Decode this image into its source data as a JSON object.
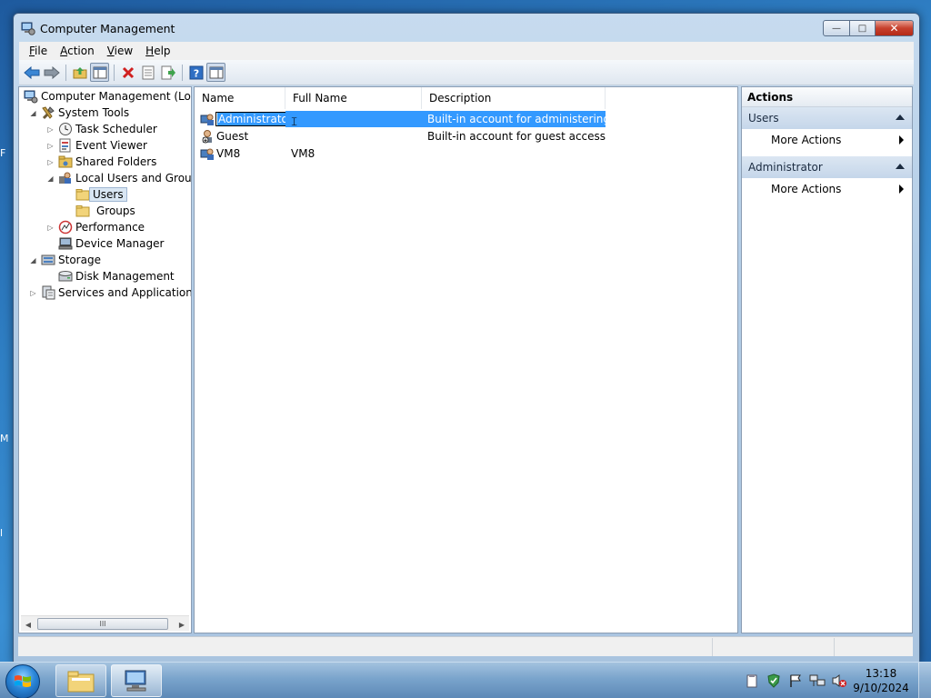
{
  "desktop": {
    "edge_glyphs": [
      "F",
      "M",
      "l"
    ]
  },
  "window": {
    "title": "Computer Management",
    "caption": {
      "minimize": "—",
      "maximize": "□",
      "close": "✕"
    }
  },
  "menu": [
    {
      "key": "F",
      "rest": "ile"
    },
    {
      "key": "A",
      "rest": "ction"
    },
    {
      "key": "V",
      "rest": "iew"
    },
    {
      "key": "H",
      "rest": "elp"
    }
  ],
  "toolbar": {
    "buttons": [
      "back-icon",
      "forward-icon",
      "up-folder-icon",
      "show-hide-tree-icon",
      "delete-icon",
      "properties-icon",
      "export-list-icon",
      "help-icon",
      "show-action-pane-icon"
    ]
  },
  "tree": {
    "items": [
      {
        "label": "Computer Management (Local",
        "icon": "computer-management-icon"
      },
      {
        "label": "System Tools",
        "icon": "system-tools-icon"
      },
      {
        "label": "Task Scheduler",
        "icon": "clock-icon"
      },
      {
        "label": "Event Viewer",
        "icon": "event-viewer-icon"
      },
      {
        "label": "Shared Folders",
        "icon": "shared-folders-icon"
      },
      {
        "label": "Local Users and Groups",
        "icon": "users-groups-icon"
      },
      {
        "label": "Users",
        "icon": "folder-icon"
      },
      {
        "label": "Groups",
        "icon": "folder-icon"
      },
      {
        "label": "Performance",
        "icon": "performance-icon"
      },
      {
        "label": "Device Manager",
        "icon": "device-manager-icon"
      },
      {
        "label": "Storage",
        "icon": "storage-icon"
      },
      {
        "label": "Disk Management",
        "icon": "disk-icon"
      },
      {
        "label": "Services and Applications",
        "icon": "services-icon"
      }
    ],
    "scroll_grip": "III"
  },
  "list": {
    "columns": [
      "Name",
      "Full Name",
      "Description"
    ],
    "rows": [
      {
        "name": "Administrator",
        "full_name": "",
        "description": "Built-in account for administering..."
      },
      {
        "name": "Guest",
        "full_name": "",
        "description": "Built-in account for guest access t..."
      },
      {
        "name": "VM8",
        "full_name": "VM8",
        "description": ""
      }
    ]
  },
  "actions": {
    "title": "Actions",
    "sections": [
      {
        "label": "Users",
        "items": [
          "More Actions"
        ]
      },
      {
        "label": "Administrator",
        "items": [
          "More Actions"
        ]
      }
    ]
  },
  "taskbar": {
    "clock_time": "13:18",
    "clock_date": "9/10/2024"
  },
  "colors": {
    "selection": "#3399ff",
    "title_bar": "#b9d1ea"
  }
}
